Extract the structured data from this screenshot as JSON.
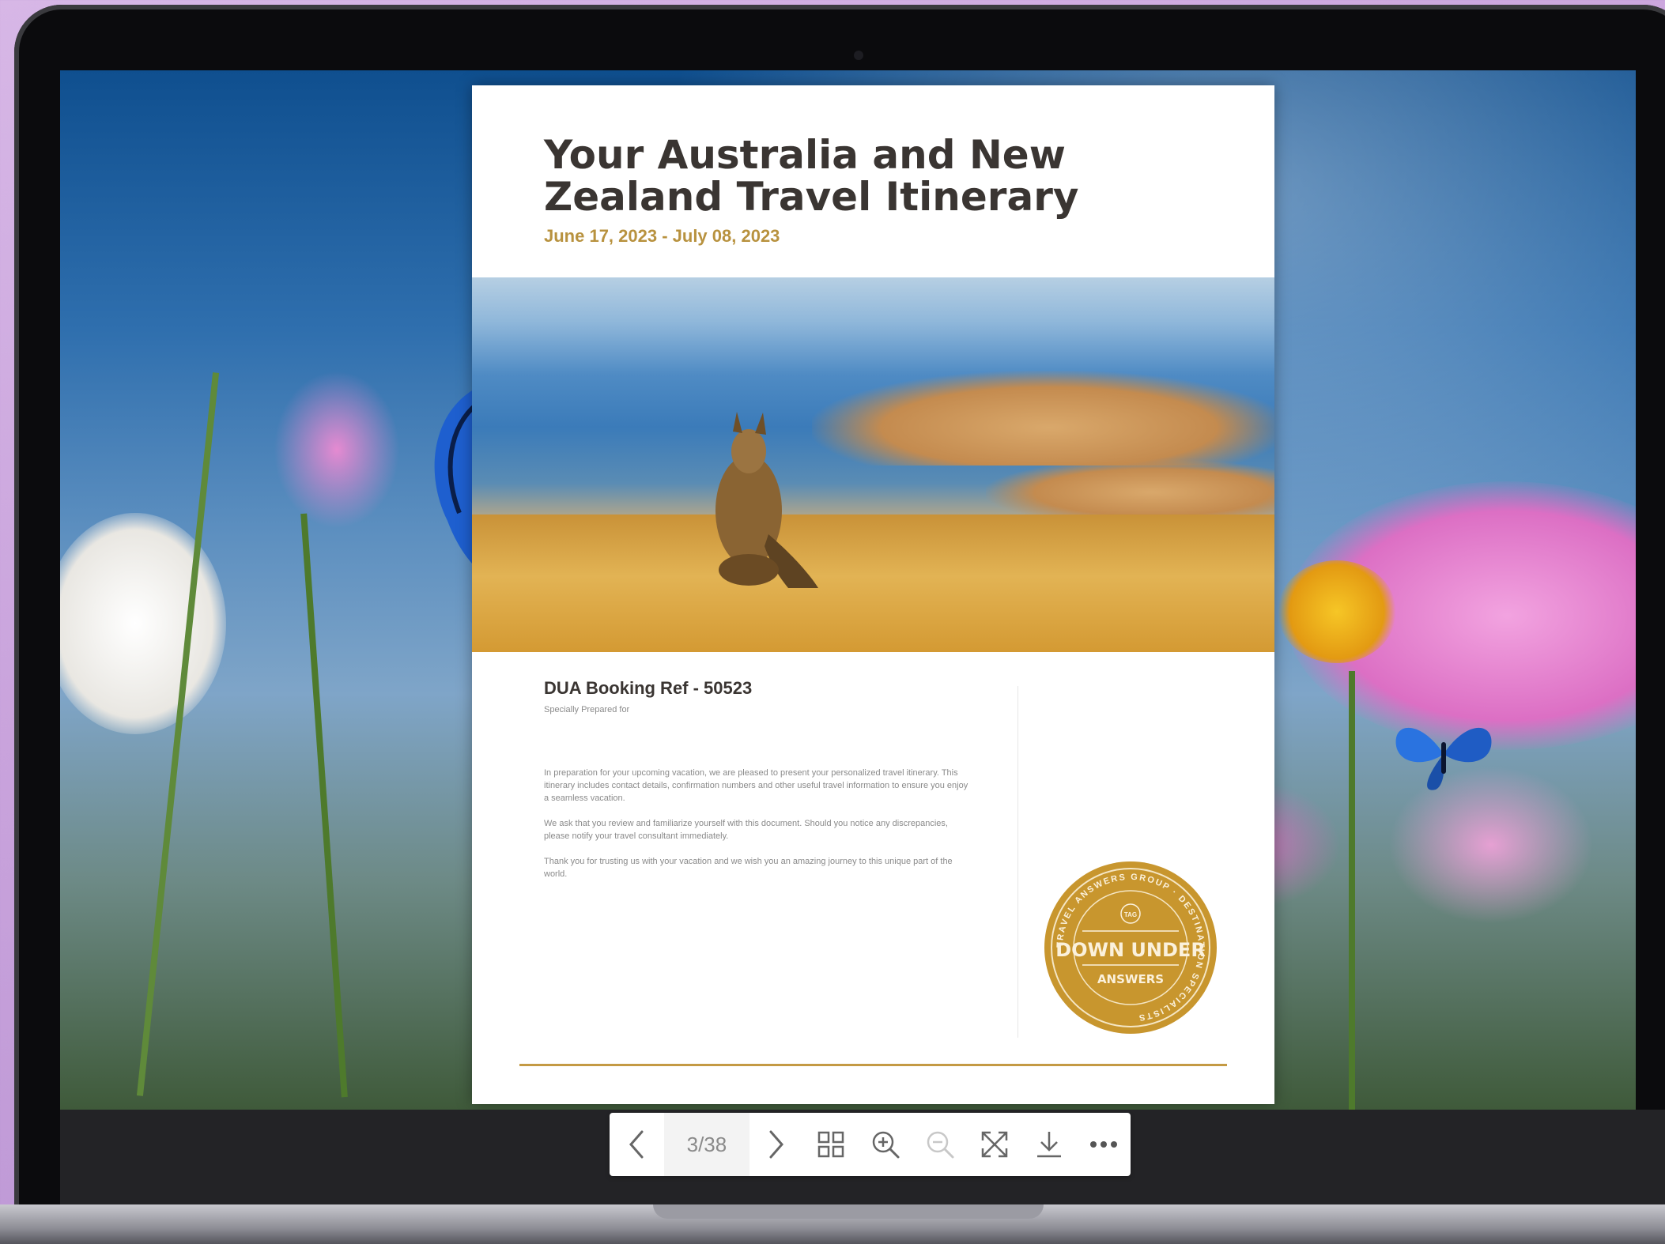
{
  "document": {
    "title": "Your Australia and New Zealand Travel Itinerary",
    "dates": "June 17, 2023 - July 08, 2023",
    "booking_ref": "DUA Booking Ref - 50523",
    "prepared_for_label": "Specially Prepared for",
    "paragraphs": [
      "In preparation for your upcoming vacation, we are pleased to present your personalized travel itinerary. This itinerary includes contact details, confirmation numbers and other useful travel information to ensure you enjoy a seamless vacation.",
      "We ask that you review and familiarize yourself with this document. Should you notice any discrepancies, please notify your travel consultant immediately.",
      "Thank you for trusting us with your vacation and we wish you an amazing journey to this unique part of the world."
    ],
    "seal": {
      "ring_text": "TRAVEL ANSWERS GROUP · DESTINATION SPECIALISTS",
      "monogram": "TAG",
      "line1": "DOWN UNDER",
      "line2": "ANSWERS",
      "color": "#c8962e"
    }
  },
  "toolbar": {
    "page_indicator": "3/38",
    "buttons": [
      "previous-page",
      "next-page",
      "thumbnails",
      "zoom-in",
      "zoom-out",
      "fullscreen",
      "download",
      "more"
    ]
  },
  "colors": {
    "accent_gold": "#b8923f",
    "title_text": "#3a3532"
  }
}
